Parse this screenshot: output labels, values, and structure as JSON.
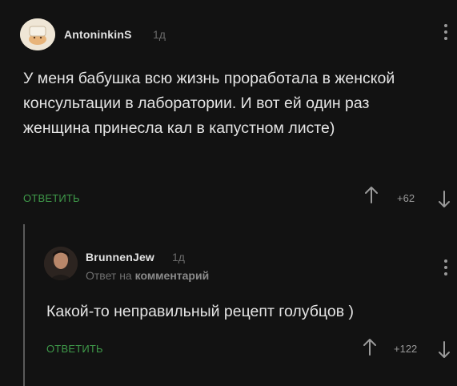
{
  "comments": [
    {
      "username": "AntoninkinS",
      "age": "1д",
      "text": "У меня бабушка всю жизнь проработала в женской консультации в лаборатории. И вот ей один раз женщина принесла кал в капустном листе)",
      "reply_label": "ОТВЕТИТЬ",
      "rating": "+62"
    },
    {
      "username": "BrunnenJew",
      "age": "1д",
      "reply_to_prefix": "Ответ на",
      "reply_to_link": "комментарий",
      "text": "Какой-то неправильный рецепт голубцов )",
      "reply_label": "ОТВЕТИТЬ",
      "rating": "+122"
    }
  ],
  "colors": {
    "background": "#121212",
    "accent_green": "#3f9b4a",
    "text": "#e4e4e4",
    "muted": "#6a6a6a"
  },
  "icons": [
    "avatar-cartoon",
    "avatar-photo",
    "arrow-up-icon",
    "arrow-down-icon",
    "more-vertical-icon"
  ]
}
